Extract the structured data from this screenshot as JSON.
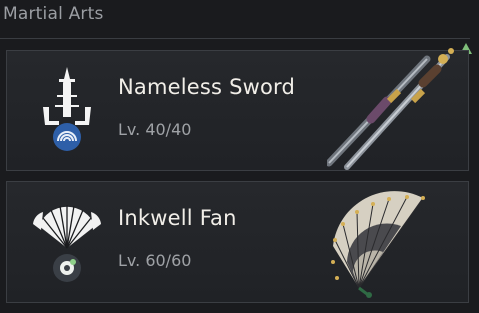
{
  "section": {
    "title": "Martial Arts"
  },
  "accent": {
    "scroll_arrow": "#7fbf7a",
    "card_bg": "#24262a",
    "icon_badge": "#2e5fa8"
  },
  "arts": [
    {
      "name": "Nameless Sword",
      "level": "Lv. 40/40",
      "icon": "sword-emblem-icon",
      "art": "sword-illustration"
    },
    {
      "name": "Inkwell Fan",
      "level": "Lv. 60/60",
      "icon": "fan-emblem-icon",
      "art": "fan-illustration"
    }
  ]
}
